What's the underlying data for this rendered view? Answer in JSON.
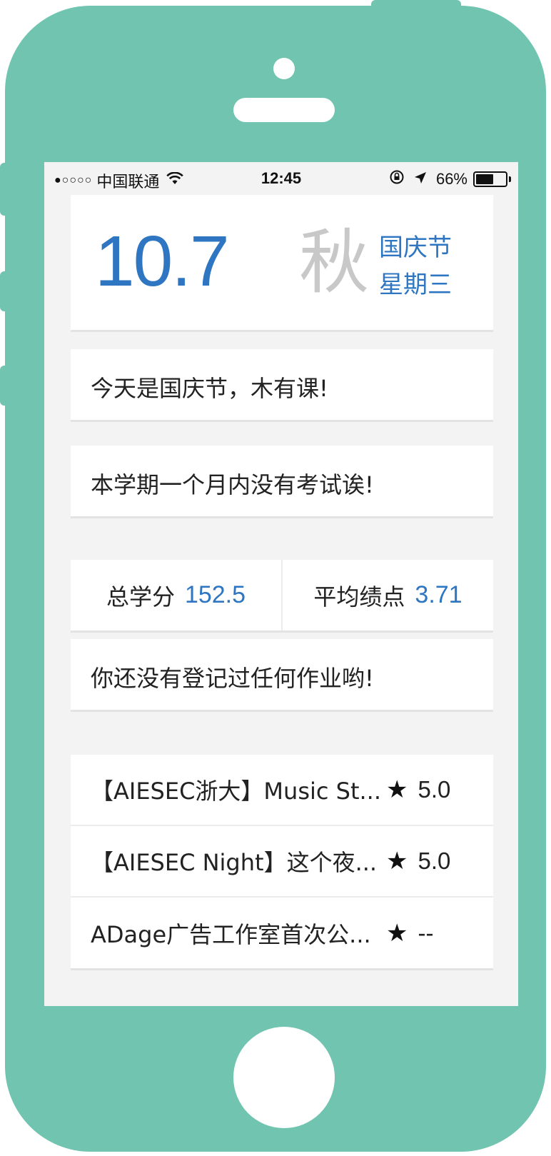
{
  "status_bar": {
    "signal": "●○○○○",
    "carrier": "中国联通",
    "time": "12:45",
    "battery_percent": "66%",
    "battery_level": 0.66
  },
  "date_card": {
    "date": "10.7",
    "season": "秋",
    "holiday": "国庆节",
    "weekday": "星期三"
  },
  "messages": {
    "classes": "今天是国庆节，木有课!",
    "exams": "本学期一个月内没有考试诶!",
    "homework": "你还没有登记过任何作业哟!"
  },
  "stats": {
    "credits_label": "总学分",
    "credits_value": "152.5",
    "gpa_label": "平均绩点",
    "gpa_value": "3.71"
  },
  "events": [
    {
      "title": "【AIESEC浙大】Music St...",
      "rating": "5.0"
    },
    {
      "title": "【AIESEC Night】这个夜...",
      "rating": "5.0"
    },
    {
      "title": "ADage广告工作室首次公...",
      "rating": "--"
    }
  ],
  "colors": {
    "frame": "#70c4b0",
    "accent": "#2f76c2",
    "season": "#c8c8c8"
  },
  "icons": [
    "wifi-icon",
    "rotation-lock-icon",
    "location-arrow-icon",
    "battery-icon",
    "star-icon"
  ]
}
